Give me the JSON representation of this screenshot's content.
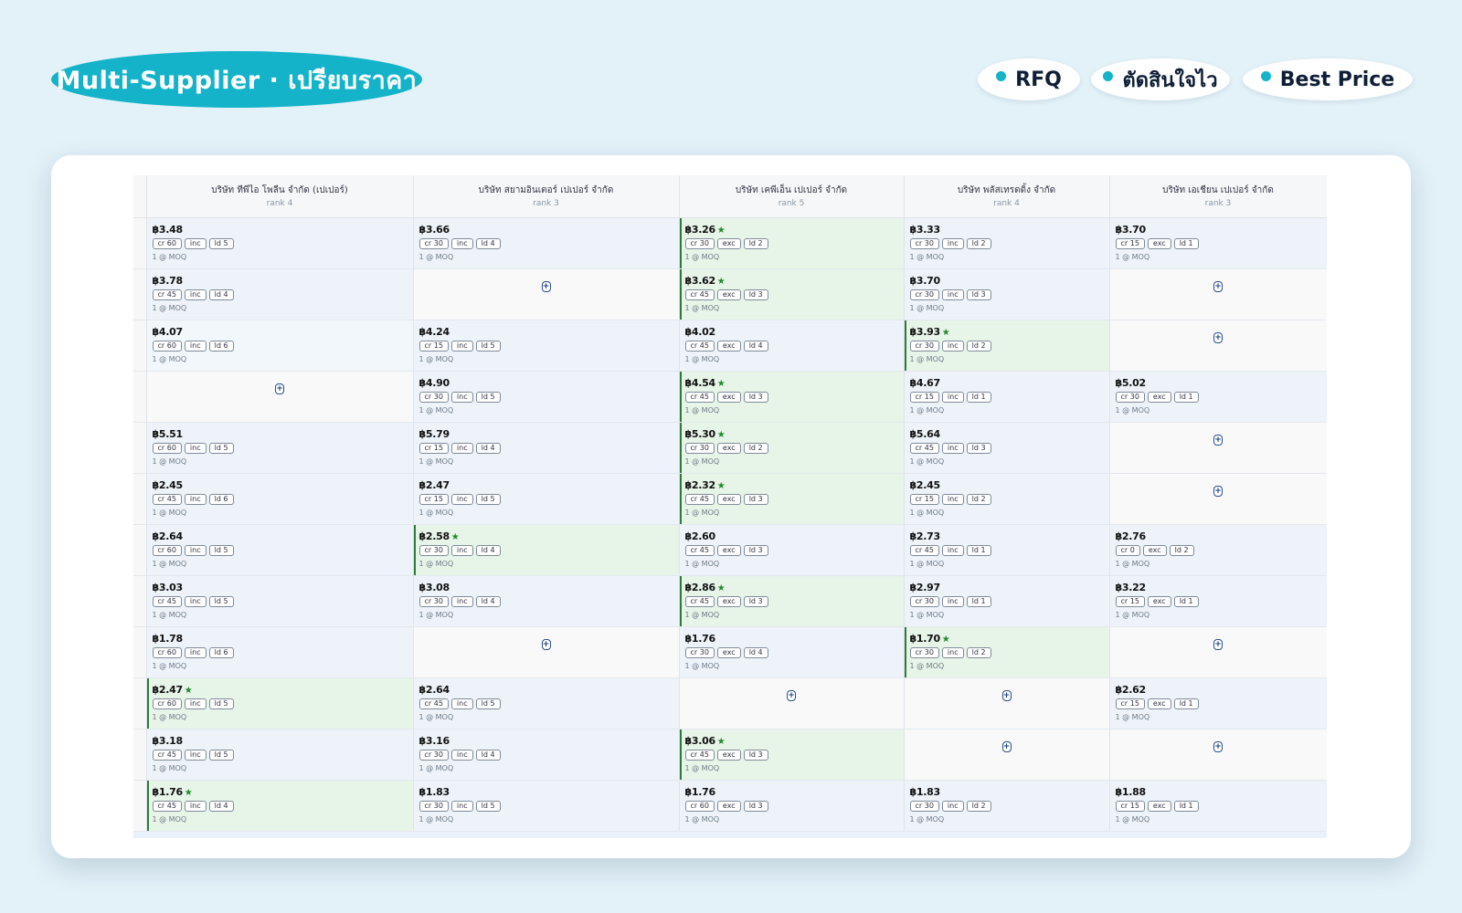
{
  "header": {
    "title": "Multi-Supplier · เปรียบราคา",
    "tags": [
      "RFQ",
      "ตัดสินใจไว",
      "Best Price"
    ]
  },
  "colors": {
    "accent": "#14b3c9",
    "best_bg": "#e7f4e8",
    "best_star": "#1e8a2e"
  },
  "table": {
    "suppliers": [
      {
        "name": "บริษัท ทีพีไอ โพลีน จำกัด (เปเปอร์)",
        "rank": "rank 4"
      },
      {
        "name": "บริษัท สยามอินเตอร์ เปเปอร์ จำกัด",
        "rank": "rank 3"
      },
      {
        "name": "บริษัท เคพีเอ็น เปเปอร์ จำกัด",
        "rank": "rank 5"
      },
      {
        "name": "บริษัท พลัสเทรดดิ้ง จำกัด",
        "rank": "rank 4"
      },
      {
        "name": "บริษัท เอเชียน เปเปอร์ จำกัด",
        "rank": "rank 3"
      }
    ],
    "add_icon": "plus-icon",
    "rows": [
      [
        {
          "price": "฿3.48",
          "cr": "cr 60",
          "tax": "inc",
          "ld": "ld 5",
          "moq": "1 @ MOQ"
        },
        {
          "price": "฿3.66",
          "cr": "cr 30",
          "tax": "inc",
          "ld": "ld 4",
          "moq": "1 @ MOQ"
        },
        {
          "price": "฿3.26",
          "best": true,
          "cr": "cr 30",
          "tax": "exc",
          "ld": "ld 2",
          "moq": "1 @ MOQ"
        },
        {
          "price": "฿3.33",
          "cr": "cr 30",
          "tax": "inc",
          "ld": "ld 2",
          "moq": "1 @ MOQ"
        },
        {
          "price": "฿3.70",
          "cr": "cr 15",
          "tax": "exc",
          "ld": "ld 1",
          "moq": "1 @ MOQ"
        }
      ],
      [
        {
          "price": "฿3.78",
          "cr": "cr 45",
          "tax": "inc",
          "ld": "ld 4",
          "moq": "1 @ MOQ"
        },
        null,
        {
          "price": "฿3.62",
          "best": true,
          "cr": "cr 45",
          "tax": "exc",
          "ld": "ld 3",
          "moq": "1 @ MOQ"
        },
        {
          "price": "฿3.70",
          "cr": "cr 30",
          "tax": "inc",
          "ld": "ld 3",
          "moq": "1 @ MOQ"
        },
        null
      ],
      [
        {
          "price": "฿4.07",
          "cr": "cr 60",
          "tax": "inc",
          "ld": "ld 6",
          "moq": "1 @ MOQ"
        },
        {
          "price": "฿4.24",
          "cr": "cr 15",
          "tax": "inc",
          "ld": "ld 5",
          "moq": "1 @ MOQ"
        },
        {
          "price": "฿4.02",
          "cr": "cr 45",
          "tax": "exc",
          "ld": "ld 4",
          "moq": "1 @ MOQ"
        },
        {
          "price": "฿3.93",
          "best": true,
          "cr": "cr 30",
          "tax": "inc",
          "ld": "ld 2",
          "moq": "1 @ MOQ"
        },
        null
      ],
      [
        null,
        {
          "price": "฿4.90",
          "cr": "cr 30",
          "tax": "inc",
          "ld": "ld 5",
          "moq": "1 @ MOQ"
        },
        {
          "price": "฿4.54",
          "best": true,
          "cr": "cr 45",
          "tax": "exc",
          "ld": "ld 3",
          "moq": "1 @ MOQ"
        },
        {
          "price": "฿4.67",
          "cr": "cr 15",
          "tax": "inc",
          "ld": "ld 1",
          "moq": "1 @ MOQ"
        },
        {
          "price": "฿5.02",
          "cr": "cr 30",
          "tax": "exc",
          "ld": "ld 1",
          "moq": "1 @ MOQ"
        }
      ],
      [
        {
          "price": "฿5.51",
          "cr": "cr 60",
          "tax": "inc",
          "ld": "ld 5",
          "moq": "1 @ MOQ"
        },
        {
          "price": "฿5.79",
          "cr": "cr 15",
          "tax": "inc",
          "ld": "ld 4",
          "moq": "1 @ MOQ"
        },
        {
          "price": "฿5.30",
          "best": true,
          "cr": "cr 30",
          "tax": "exc",
          "ld": "ld 2",
          "moq": "1 @ MOQ"
        },
        {
          "price": "฿5.64",
          "cr": "cr 45",
          "tax": "inc",
          "ld": "ld 3",
          "moq": "1 @ MOQ"
        },
        null
      ],
      [
        {
          "price": "฿2.45",
          "cr": "cr 45",
          "tax": "inc",
          "ld": "ld 6",
          "moq": "1 @ MOQ"
        },
        {
          "price": "฿2.47",
          "cr": "cr 15",
          "tax": "inc",
          "ld": "ld 5",
          "moq": "1 @ MOQ"
        },
        {
          "price": "฿2.32",
          "best": true,
          "cr": "cr 45",
          "tax": "exc",
          "ld": "ld 3",
          "moq": "1 @ MOQ"
        },
        {
          "price": "฿2.45",
          "cr": "cr 15",
          "tax": "inc",
          "ld": "ld 2",
          "moq": "1 @ MOQ"
        },
        null
      ],
      [
        {
          "price": "฿2.64",
          "cr": "cr 60",
          "tax": "inc",
          "ld": "ld 5",
          "moq": "1 @ MOQ"
        },
        {
          "price": "฿2.58",
          "best": true,
          "cr": "cr 30",
          "tax": "inc",
          "ld": "ld 4",
          "moq": "1 @ MOQ"
        },
        {
          "price": "฿2.60",
          "cr": "cr 45",
          "tax": "exc",
          "ld": "ld 3",
          "moq": "1 @ MOQ"
        },
        {
          "price": "฿2.73",
          "cr": "cr 45",
          "tax": "inc",
          "ld": "ld 1",
          "moq": "1 @ MOQ"
        },
        {
          "price": "฿2.76",
          "cr": "cr 0",
          "tax": "exc",
          "ld": "ld 2",
          "moq": "1 @ MOQ"
        }
      ],
      [
        {
          "price": "฿3.03",
          "cr": "cr 45",
          "tax": "inc",
          "ld": "ld 5",
          "moq": "1 @ MOQ"
        },
        {
          "price": "฿3.08",
          "cr": "cr 30",
          "tax": "inc",
          "ld": "ld 4",
          "moq": "1 @ MOQ"
        },
        {
          "price": "฿2.86",
          "best": true,
          "cr": "cr 45",
          "tax": "exc",
          "ld": "ld 3",
          "moq": "1 @ MOQ"
        },
        {
          "price": "฿2.97",
          "cr": "cr 30",
          "tax": "inc",
          "ld": "ld 1",
          "moq": "1 @ MOQ"
        },
        {
          "price": "฿3.22",
          "cr": "cr 15",
          "tax": "exc",
          "ld": "ld 1",
          "moq": "1 @ MOQ"
        }
      ],
      [
        {
          "price": "฿1.78",
          "cr": "cr 60",
          "tax": "inc",
          "ld": "ld 6",
          "moq": "1 @ MOQ"
        },
        null,
        {
          "price": "฿1.76",
          "cr": "cr 30",
          "tax": "exc",
          "ld": "ld 4",
          "moq": "1 @ MOQ"
        },
        {
          "price": "฿1.70",
          "best": true,
          "cr": "cr 30",
          "tax": "inc",
          "ld": "ld 2",
          "moq": "1 @ MOQ"
        },
        null
      ],
      [
        {
          "price": "฿2.47",
          "best": true,
          "cr": "cr 60",
          "tax": "inc",
          "ld": "ld 5",
          "moq": "1 @ MOQ"
        },
        {
          "price": "฿2.64",
          "cr": "cr 45",
          "tax": "inc",
          "ld": "ld 5",
          "moq": "1 @ MOQ"
        },
        null,
        null,
        {
          "price": "฿2.62",
          "cr": "cr 15",
          "tax": "exc",
          "ld": "ld 1",
          "moq": "1 @ MOQ"
        }
      ],
      [
        {
          "price": "฿3.18",
          "cr": "cr 45",
          "tax": "inc",
          "ld": "ld 5",
          "moq": "1 @ MOQ"
        },
        {
          "price": "฿3.16",
          "cr": "cr 30",
          "tax": "inc",
          "ld": "ld 4",
          "moq": "1 @ MOQ"
        },
        {
          "price": "฿3.06",
          "best": true,
          "cr": "cr 45",
          "tax": "exc",
          "ld": "ld 3",
          "moq": "1 @ MOQ"
        },
        null,
        null
      ],
      [
        {
          "price": "฿1.76",
          "best": true,
          "cr": "cr 45",
          "tax": "inc",
          "ld": "ld 4",
          "moq": "1 @ MOQ"
        },
        {
          "price": "฿1.83",
          "cr": "cr 30",
          "tax": "inc",
          "ld": "ld 5",
          "moq": "1 @ MOQ"
        },
        {
          "price": "฿1.76",
          "cr": "cr 60",
          "tax": "exc",
          "ld": "ld 3",
          "moq": "1 @ MOQ"
        },
        {
          "price": "฿1.83",
          "cr": "cr 30",
          "tax": "inc",
          "ld": "ld 2",
          "moq": "1 @ MOQ"
        },
        {
          "price": "฿1.88",
          "cr": "cr 15",
          "tax": "exc",
          "ld": "ld 1",
          "moq": "1 @ MOQ"
        }
      ]
    ]
  }
}
